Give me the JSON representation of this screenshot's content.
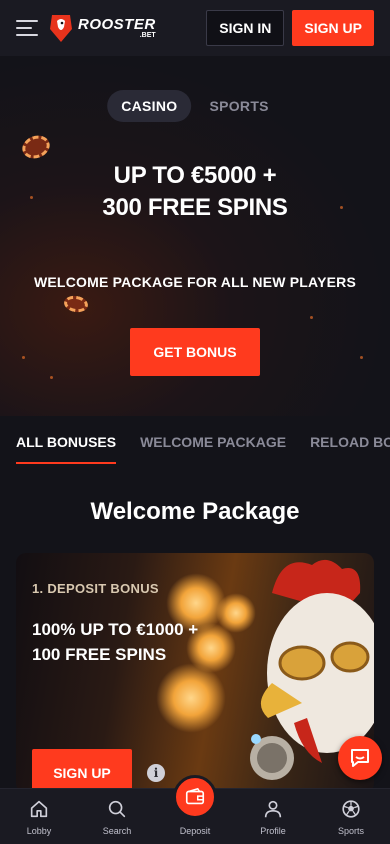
{
  "header": {
    "logo_text": "ROOSTER",
    "logo_sub": ".BET",
    "signin_label": "SIGN IN",
    "signup_label": "SIGN UP"
  },
  "hero": {
    "segments": [
      {
        "label": "CASINO",
        "active": true
      },
      {
        "label": "SPORTS",
        "active": false
      }
    ],
    "title_line1": "UP TO €5000 +",
    "title_line2": "300 FREE SPINS",
    "subtitle": "WELCOME PACKAGE FOR ALL NEW PLAYERS",
    "cta_label": "GET BONUS"
  },
  "tabs": [
    {
      "label": "ALL BONUSES",
      "active": true
    },
    {
      "label": "WELCOME PACKAGE",
      "active": false
    },
    {
      "label": "RELOAD BONUS",
      "active": false
    }
  ],
  "section_title": "Welcome Package",
  "card": {
    "step": "1. DEPOSIT BONUS",
    "title_line1": "100% UP TO €1000 +",
    "title_line2": "100 FREE SPINS",
    "cta_label": "SIGN UP",
    "info_icon": "i"
  },
  "bottom_nav": [
    {
      "label": "Lobby",
      "icon": "home-icon"
    },
    {
      "label": "Search",
      "icon": "search-icon"
    },
    {
      "label": "Deposit",
      "icon": "wallet-icon"
    },
    {
      "label": "Profile",
      "icon": "user-icon"
    },
    {
      "label": "Sports",
      "icon": "soccer-ball-icon"
    }
  ],
  "colors": {
    "accent": "#ff3a1e",
    "background": "#131319",
    "header": "#1a1a22"
  }
}
